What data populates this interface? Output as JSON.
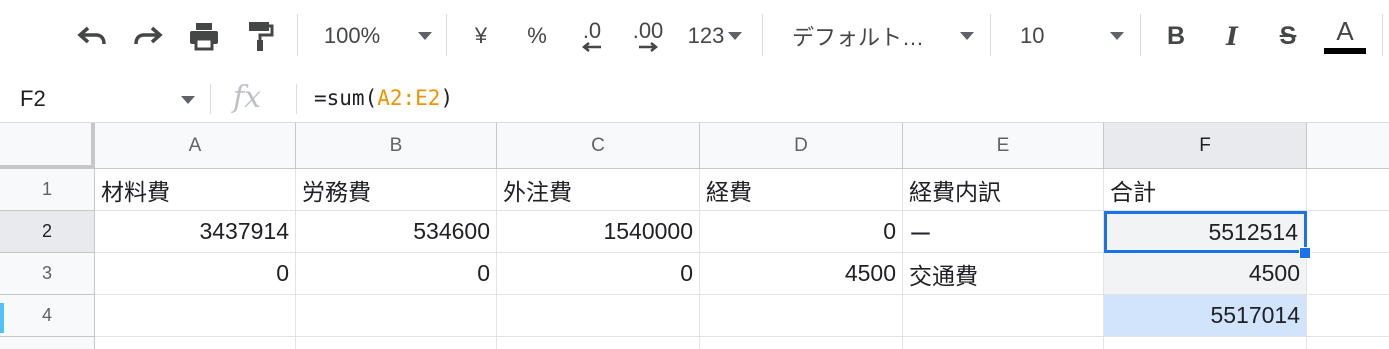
{
  "toolbar": {
    "zoom": "100%",
    "currency": "¥",
    "percent": "%",
    "decrease_decimal": ".0",
    "increase_decimal": ".00",
    "more_formats": "123",
    "font": "デフォルト…",
    "font_size": "10",
    "bold": "B",
    "italic": "I",
    "strikethrough": "S",
    "text_color": "A",
    "text_color_value": "#000000"
  },
  "formula_bar": {
    "cell_ref": "F2",
    "fx": "fx",
    "formula_prefix": "=sum(",
    "formula_range": "A2:E2",
    "formula_suffix": ")"
  },
  "sheet": {
    "columns": [
      "A",
      "B",
      "C",
      "D",
      "E",
      "F"
    ],
    "rows": [
      "1",
      "2",
      "3",
      "4"
    ],
    "cells": {
      "A1": "材料費",
      "B1": "労務費",
      "C1": "外注費",
      "D1": "経費",
      "E1": "経費内訳",
      "F1": "合計",
      "A2": "3437914",
      "B2": "534600",
      "C2": "1540000",
      "D2": "0",
      "E2": "ー",
      "F2": "5512514",
      "A3": "0",
      "B3": "0",
      "C3": "0",
      "D3": "4500",
      "E3": "交通費",
      "F3": "4500",
      "F4": "5517014"
    },
    "active_cell": "F2",
    "selection_color": "#1a73e8"
  }
}
